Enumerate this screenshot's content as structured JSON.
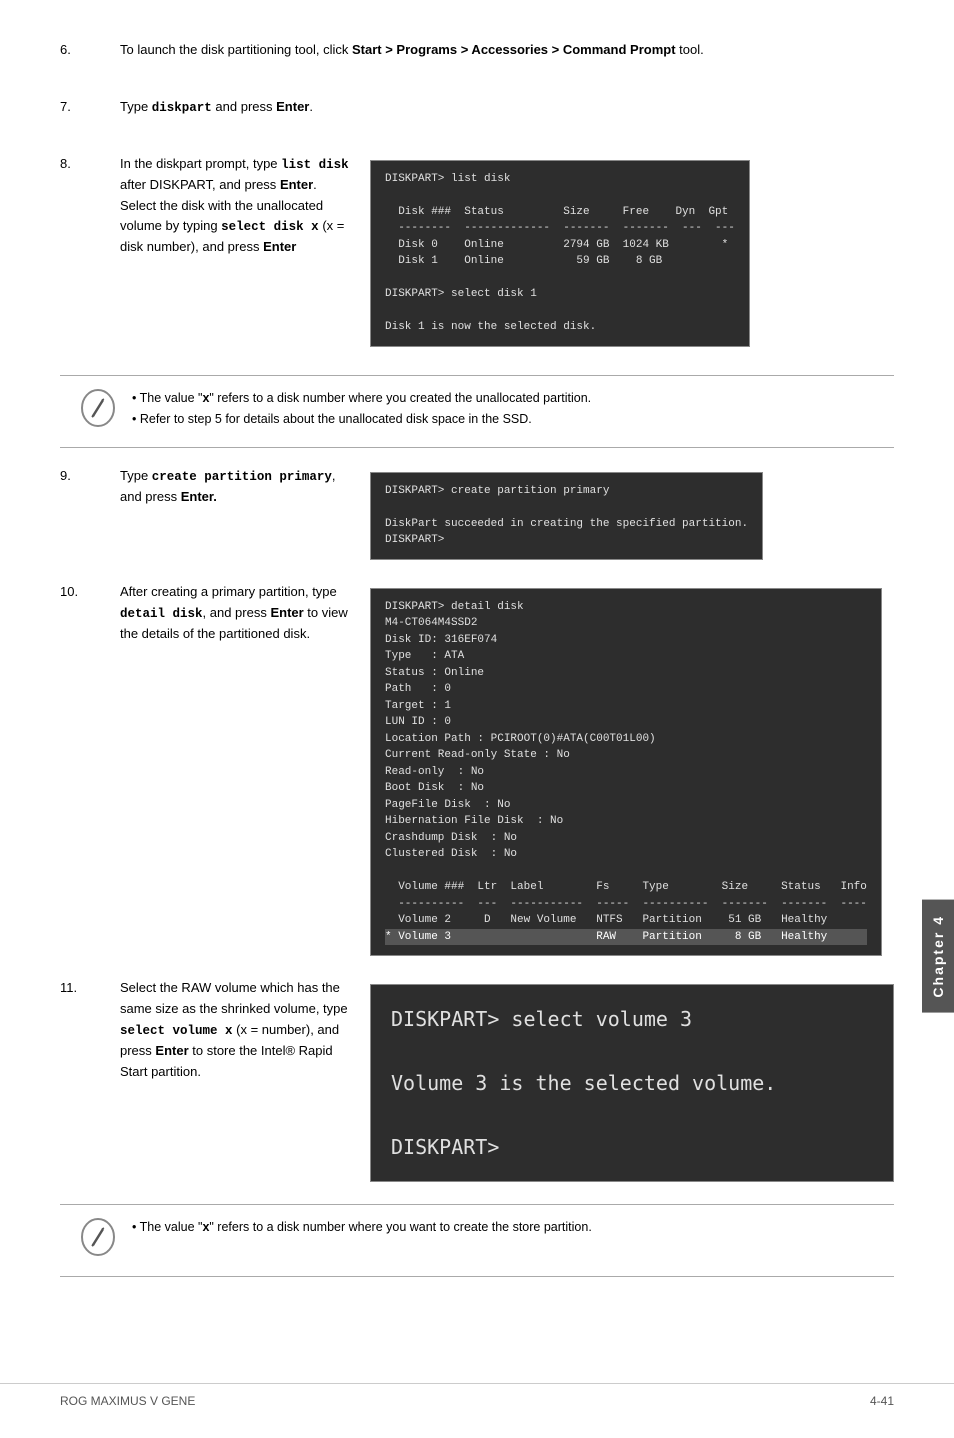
{
  "steps": [
    {
      "number": "6.",
      "text_parts": [
        {
          "text": "To launch the disk partitioning tool, click ",
          "bold": false
        },
        {
          "text": "Start > Programs > Accessories > Command Prompt",
          "bold": true
        },
        {
          "text": " tool.",
          "bold": false
        }
      ],
      "has_terminal": false
    },
    {
      "number": "7.",
      "text_parts": [
        {
          "text": "Type ",
          "bold": false
        },
        {
          "text": "diskpart",
          "bold": true,
          "code": true
        },
        {
          "text": " and press ",
          "bold": false
        },
        {
          "text": "Enter",
          "bold": true
        },
        {
          "text": ".",
          "bold": false
        }
      ],
      "has_terminal": false
    },
    {
      "number": "8.",
      "text_parts": [
        {
          "text": "In the diskpart prompt, type ",
          "bold": false
        },
        {
          "text": "list disk",
          "bold": true,
          "code": true
        },
        {
          "text": " after DISKPART, and press ",
          "bold": false
        },
        {
          "text": "Enter",
          "bold": true
        },
        {
          "text": ". Select the disk with the unallocated volume by typing ",
          "bold": false
        },
        {
          "text": "select disk x",
          "bold": true,
          "code": true
        },
        {
          "text": " (x = disk number), and press ",
          "bold": false
        },
        {
          "text": "Enter",
          "bold": true
        }
      ],
      "terminal_content": "DISKPART> list disk\n\n  Disk ###  Status         Size     Free    Dyn  Gpt\n  --------  -------------  -------  -------  ---  ---\n  Disk 0    Online         2794 GB  1024 KB        *\n  Disk 1    Online           59 GB    8 GB\n\nDISKPART> select disk 1\n\nDisk 1 is now the selected disk."
    }
  ],
  "note1": {
    "bullet1": "The value \"x\" refers to a disk number where you created the unallocated partition.",
    "bullet2": "Refer to step 5 for details about the unallocated disk space in the SSD."
  },
  "step9": {
    "number": "9.",
    "left_text_parts": [
      {
        "text": "Type ",
        "bold": false
      },
      {
        "text": "create partition primary",
        "bold": true,
        "code": true
      },
      {
        "text": ", and press ",
        "bold": false
      },
      {
        "text": "Enter",
        "bold": true
      },
      {
        "text": ".",
        "bold": false
      }
    ],
    "terminal_content": "DISKPART> create partition primary\n\nDiskPart succeeded in creating the specified partition.\nDISKPART>"
  },
  "step10": {
    "number": "10.",
    "left_text_parts": [
      {
        "text": "After creating a primary partition, type ",
        "bold": false
      },
      {
        "text": "detail disk",
        "bold": true,
        "code": true
      },
      {
        "text": ", and press ",
        "bold": false
      },
      {
        "text": "Enter",
        "bold": true
      },
      {
        "text": " to view the details of the partitioned disk.",
        "bold": false
      }
    ],
    "terminal_content": "DISKPART> detail disk\nM4-CT064M4SSD2\nDisk ID: 316EF074\nType   : ATA\nStatus : Online\nPath   : 0\nTarget : 1\nLUN ID : 0\nLocation Path : PCIROOT(0)#ATA(C00T01L00)\nCurrent Read-only State : No\nRead-only  : No\nBoot Disk  : No\nPagefile Disk  : No\nHibernation File Disk  : No\nCrashdump Disk  : No\nClustered Disk  : No\n\n  Volume ###  Ltr  Label        Fs     Type        Size     Status   Info\n  ----------  ---  -----------  -----  ----------  -------  -------  ----\n  Volume 2     D   New Volume   NTFS   Partition    51 GB   Healthy\n* Volume 3                      RAW    Partition     8 GB   Healthy"
  },
  "step11": {
    "number": "11.",
    "left_text_parts": [
      {
        "text": "Select the RAW volume which has the same size as the shrinked volume, type ",
        "bold": false
      },
      {
        "text": "select volume x",
        "bold": true,
        "code": true
      },
      {
        "text": " (x = number), and press ",
        "bold": false
      },
      {
        "text": "Enter",
        "bold": true
      },
      {
        "text": " to store the Intel® Rapid Start partition.",
        "bold": false
      }
    ],
    "terminal_content": "DISKPART> select volume 3\n\nVolume 3 is the selected volume.\n\nDISKPART>"
  },
  "note2": {
    "bullet1": "The value \"x\" refers to a disk number where you want to create the store partition."
  },
  "footer": {
    "left": "ROG MAXIMUS V GENE",
    "right": "4-41",
    "chapter_label": "Chapter 4"
  }
}
